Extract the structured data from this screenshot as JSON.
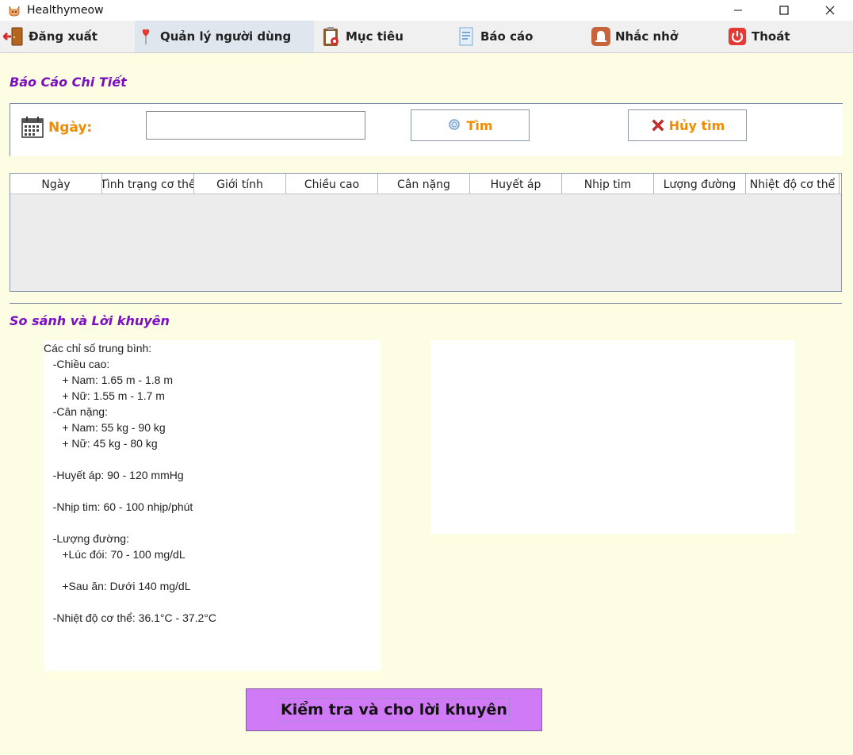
{
  "window": {
    "title": "Healthymeow"
  },
  "menu": {
    "items": [
      {
        "label": "Đăng xuất",
        "icon": "logout-door-icon"
      },
      {
        "label": "Quản lý người dùng",
        "icon": "heart-pin-icon"
      },
      {
        "label": "Mục tiêu",
        "icon": "clipboard-target-icon"
      },
      {
        "label": "Báo cáo",
        "icon": "report-document-icon"
      },
      {
        "label": "Nhắc nhở",
        "icon": "bell-icon"
      },
      {
        "label": "Thoát",
        "icon": "power-icon"
      }
    ],
    "active_index": 1
  },
  "report": {
    "title": "Báo Cáo Chi Tiết",
    "date_label": "Ngày:",
    "date_value": "",
    "search_label": "Tìm",
    "cancel_label": "Hủy tìm",
    "columns": [
      "Ngày",
      "Tình trạng cơ thể",
      "Giới tính",
      "Chiều cao",
      "Cân nặng",
      "Huyết áp",
      "Nhịp tim",
      "Lượng đường",
      "Nhiệt độ cơ thể"
    ],
    "rows": []
  },
  "compare": {
    "title": "So sánh và Lời khuyên",
    "averages": [
      "Các chỉ số trung bình:",
      "   -Chiều cao:",
      "      + Nam: 1.65 m - 1.8 m",
      "      + Nữ: 1.55 m - 1.7 m",
      "   -Cân nặng:",
      "      + Nam: 55 kg - 90 kg",
      "      + Nữ: 45 kg - 80 kg",
      "",
      "   -Huyết áp: 90 - 120 mmHg",
      "",
      "   -Nhịp tim: 60 - 100 nhịp/phút",
      "",
      "   -Lượng đường:",
      "      +Lúc đói: 70 - 100 mg/dL",
      "",
      "      +Sau ăn: Dưới 140 mg/dL",
      "",
      "   -Nhiệt độ cơ thể: 36.1°C - 37.2°C"
    ],
    "advice_text": "",
    "check_button_label": "Kiểm tra và cho lời khuyên"
  },
  "colors": {
    "background": "#fdfde3",
    "section_title": "#7a0fc2",
    "accent_orange": "#f08c00",
    "check_button": "#d17af5"
  }
}
